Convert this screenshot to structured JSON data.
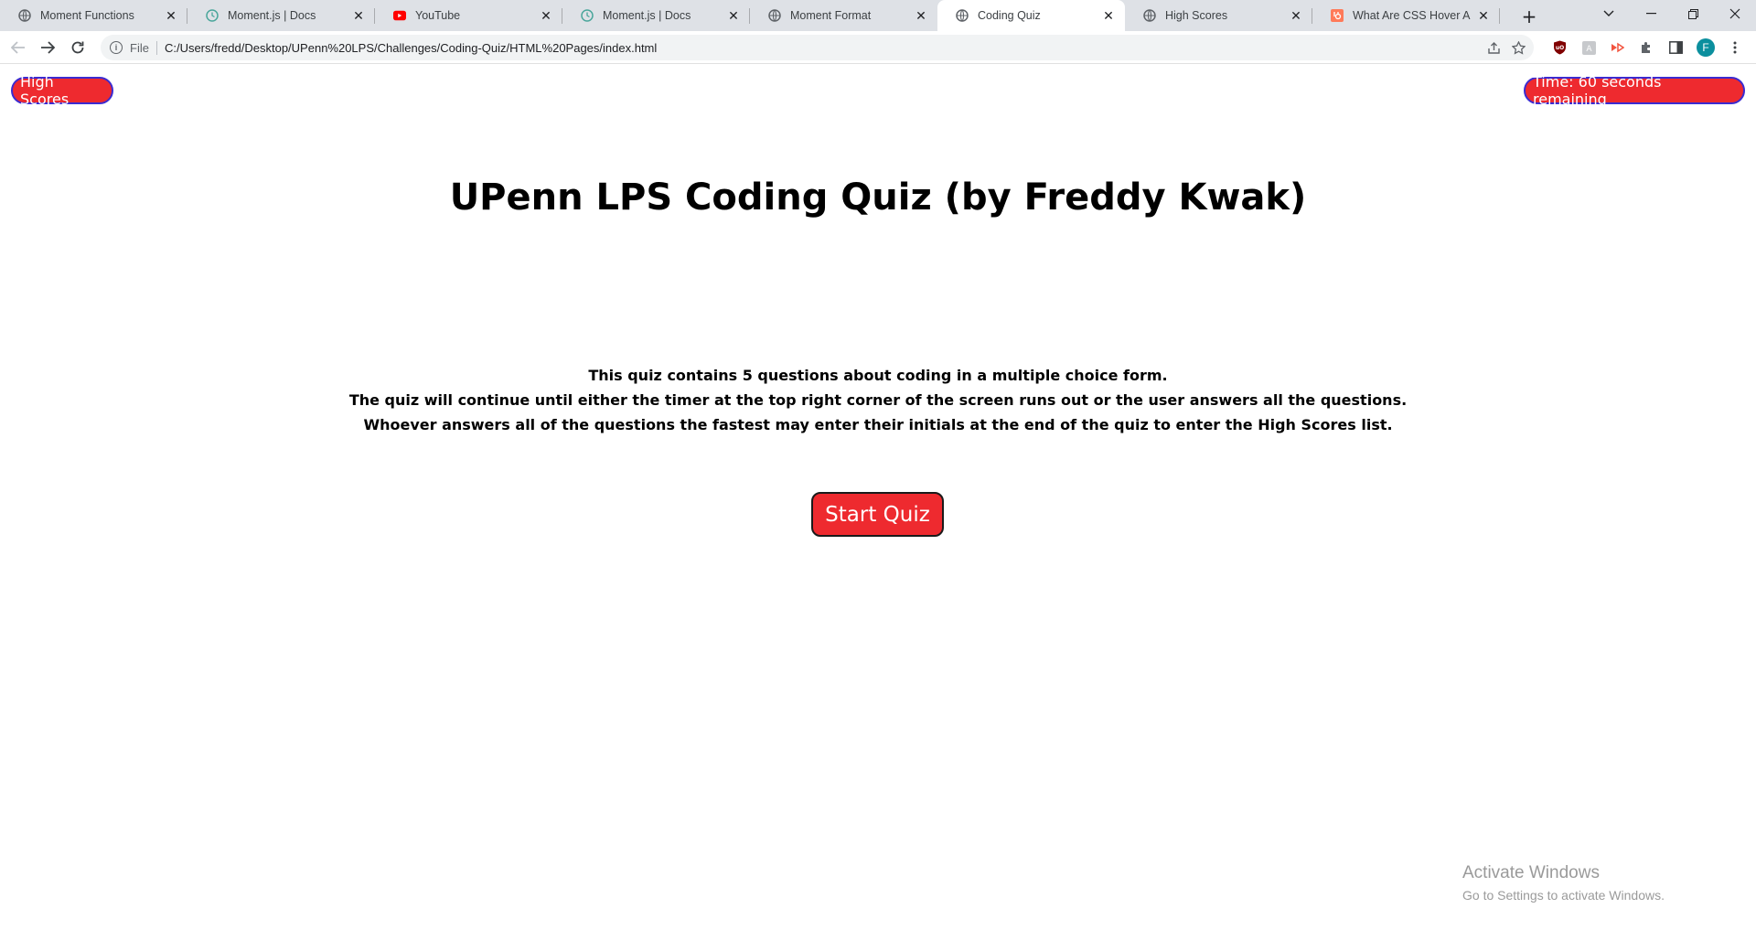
{
  "browser": {
    "tabs": [
      {
        "title": "Moment Functions",
        "icon": "globe-icon"
      },
      {
        "title": "Moment.js | Docs",
        "icon": "clock-icon"
      },
      {
        "title": "YouTube",
        "icon": "youtube-icon"
      },
      {
        "title": "Moment.js | Docs",
        "icon": "clock-icon"
      },
      {
        "title": "Moment Format",
        "icon": "globe-icon"
      },
      {
        "title": "Coding Quiz",
        "icon": "globe-icon",
        "active": true
      },
      {
        "title": "High Scores",
        "icon": "globe-icon"
      },
      {
        "title": "What Are CSS Hover Anim",
        "icon": "hubspot-icon"
      }
    ],
    "new_tab_label": "+",
    "address": {
      "scheme_label": "File",
      "url": "C:/Users/fredd/Desktop/UPenn%20LPS/Challenges/Coding-Quiz/HTML%20Pages/index.html"
    },
    "profile_initial": "F"
  },
  "page": {
    "high_scores_button": "High Scores",
    "timer_text": "Time: 60 seconds remaining",
    "title": "UPenn LPS Coding Quiz (by Freddy Kwak)",
    "instructions": [
      "This quiz contains 5 questions about coding in a multiple choice form.",
      "The quiz will continue until either the timer at the top right corner of the screen runs out or the user answers all the questions.",
      "Whoever answers all of the questions the fastest may enter their initials at the end of the quiz to enter the High Scores list."
    ],
    "start_button": "Start Quiz"
  },
  "watermark": {
    "title": "Activate Windows",
    "subtitle": "Go to Settings to activate Windows."
  },
  "colors": {
    "accent_red": "#ee2a2f",
    "pill_border": "#3b2bd1",
    "tabstrip_bg": "#dee1e6"
  }
}
